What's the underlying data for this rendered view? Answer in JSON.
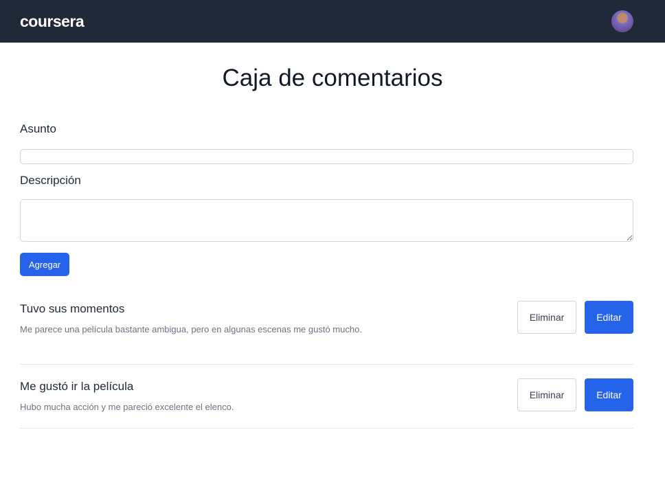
{
  "header": {
    "logo": "coursera"
  },
  "page": {
    "title": "Caja de comentarios"
  },
  "form": {
    "subject_label": "Asunto",
    "subject_value": "",
    "description_label": "Descripción",
    "description_value": "",
    "submit_label": "Agregar"
  },
  "comments": [
    {
      "title": "Tuvo sus momentos",
      "description": "Me parece una película bastante ambigua, pero en algunas escenas me gustó mucho.",
      "delete_label": "Eliminar",
      "edit_label": "Editar"
    },
    {
      "title": "Me gustó ir la película",
      "description": "Hubo mucha acción y me pareció excelente el elenco.",
      "delete_label": "Eliminar",
      "edit_label": "Editar"
    }
  ]
}
